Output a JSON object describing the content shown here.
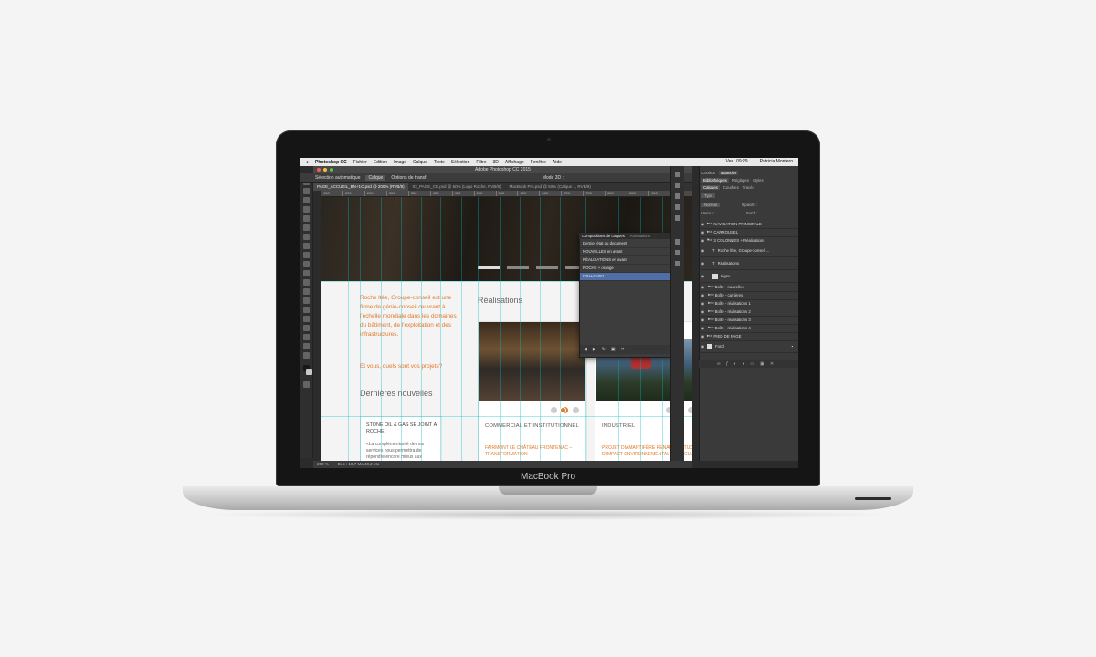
{
  "device": {
    "brand": "MacBook Pro"
  },
  "menubar": {
    "app": "Photoshop CC",
    "items": [
      "Fichier",
      "Edition",
      "Image",
      "Calque",
      "Texte",
      "Sélection",
      "Filtre",
      "3D",
      "Affichage",
      "Fenêtre",
      "Aide"
    ],
    "clock": "Ven. 09:29",
    "user": "Patricia Montero"
  },
  "window": {
    "title": "Adobe Photoshop CC 2015"
  },
  "options": {
    "auto_select": "Sélection automatique",
    "mode": "Calque",
    "transform": "Options de transf.",
    "mode3d": "Mode 3D :"
  },
  "tabs": [
    "PAGE_ACCUEIL_BN+1C.psd @ 200% (RVB/8)",
    "03_PAGE_CE.psd @ 50% (Logo Roche, RVB/8)",
    "MacBook Pro.psd @ 50% (Calque 1, RVB/8)"
  ],
  "ruler": [
    "150",
    "200",
    "250",
    "300",
    "350",
    "400",
    "450",
    "500",
    "550",
    "600",
    "650",
    "700",
    "750",
    "800",
    "850",
    "900",
    "950"
  ],
  "status": {
    "zoom": "200 %",
    "doc": "Doc : 10,7 Mo/40,2 Mo"
  },
  "page": {
    "intro": "Roche ltée, Groupe-conseil est une firme de génie-conseil œuvrant à l'échelle mondiale dans les domaines du bâtiment, de l'exploitation et des infrastructures.",
    "question": "Et vous, quels sont vos projets?",
    "news_heading": "Dernières nouvelles",
    "news_title": "STONE OIL & GAS SE JOINT À ROCHE",
    "news_body": "«La complémentarité de nos services nous permettra de répondre encore mieux aux",
    "realisations_heading": "Réalisations",
    "cards": [
      {
        "title": "COMMERCIAL ET INSTITUTIONNEL",
        "link": "FAIRMONT LE CHÂTEAU FRONTENAC – TRANSFORMATION"
      },
      {
        "title": "INDUSTRIEL",
        "link": "PROJET DIAMANTIFÈRE RENARD – ÉTUDE D'IMPACT ENVIRONNEMENTAL ET SOCIAL"
      }
    ]
  },
  "comps_panel": {
    "tabs": [
      "Compositions de calques",
      "Annotations"
    ],
    "rows": [
      "Dernier état du document",
      "NOUVELLES en avant",
      "RÉALISATIONS en avant",
      "ROCHE + orange",
      "ROLLOVER"
    ]
  },
  "layers_panel": {
    "top_tabs": [
      "Couleur",
      "Nuancier"
    ],
    "tabs2": [
      "Bibliothèques",
      "Réglages",
      "Styles"
    ],
    "tabs3": [
      "Calques",
      "Couches",
      "Tracés"
    ],
    "kind": "Type",
    "blend": "Normal",
    "opacity": "Opacité :",
    "lock": "Verrou :",
    "fill": "Fond :",
    "layers": [
      "NAVIGATION PRINCIPALE",
      "CARROUSEL",
      "3 COLONNES + Réalisations",
      "Roche ltée, Groupe-conseil ...",
      "Réalisations",
      "Ligne",
      "Boîte - nouvelles",
      "Boîte - carrières",
      "Boîte - réalisations 1",
      "Boîte - réalisations 2",
      "Boîte - réalisations 3",
      "Boîte - réalisations 4",
      "PIED DE PAGE",
      "Fond"
    ]
  },
  "colors": {
    "accent": "#e07a2a",
    "selection": "#4f6fa6",
    "guide": "#00bec8"
  }
}
